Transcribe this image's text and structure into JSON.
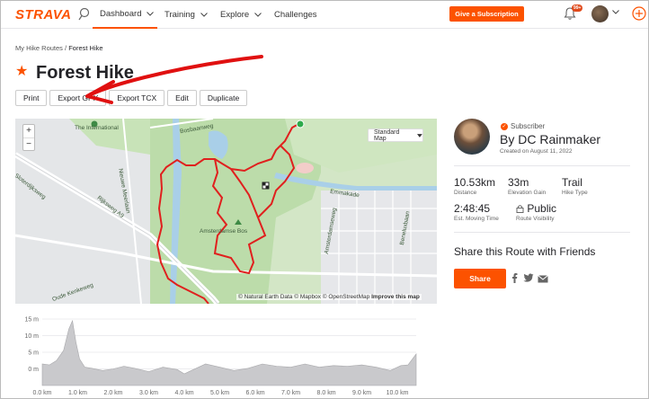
{
  "header": {
    "brand": "STRAVA",
    "nav": [
      "Dashboard",
      "Training",
      "Explore",
      "Challenges"
    ],
    "subscribe": "Give a Subscription",
    "notification_count": "99+"
  },
  "breadcrumb": {
    "parent": "My Hike Routes",
    "sep": " / ",
    "current": "Forest Hike"
  },
  "route": {
    "title": "Forest Hike"
  },
  "actions": [
    "Print",
    "Export GPX",
    "Export TCX",
    "Edit",
    "Duplicate"
  ],
  "map": {
    "zoom_in": "+",
    "zoom_out": "−",
    "type": "Standard Map",
    "labels": [
      "The International",
      "Amsterdamse Bos",
      "Bosbaanweg",
      "Nieuwe Meerlaan",
      "Rijksweg A9",
      "Emmakade",
      "Amsterdamseweg",
      "Beneluxbaan",
      "Sloterdijksweg",
      "Oude Kenkeweg"
    ],
    "attribution": {
      "prefix": "© Natural Earth Data © Mapbox © OpenStreetMap",
      "link": "Improve this map"
    }
  },
  "athlete": {
    "badge": "Subscriber",
    "name": "By DC Rainmaker",
    "created": "Created on August 11, 2022"
  },
  "stats": [
    {
      "value": "10.53km",
      "label": "Distance"
    },
    {
      "value": "33m",
      "label": "Elevation Gain"
    },
    {
      "value": "Trail",
      "label": "Hike Type"
    },
    {
      "value": "2:48:45",
      "label": "Est. Moving Time"
    },
    {
      "value": "Public",
      "label": "Route Visibility"
    }
  ],
  "share": {
    "heading": "Share this Route with Friends",
    "button": "Share"
  },
  "colors": {
    "accent": "#fc5200",
    "route": "#e0201e",
    "annotation": "#e01010"
  },
  "chart_data": {
    "type": "area",
    "xlabel": "",
    "ylabel": "",
    "ylim": [
      -5,
      15
    ],
    "xlim": [
      0,
      10.53
    ],
    "x_ticks": [
      "0.0 km",
      "1.0 km",
      "2.0 km",
      "3.0 km",
      "4.0 km",
      "5.0 km",
      "6.0 km",
      "7.0 km",
      "8.0 km",
      "9.0 km",
      "10.0 km"
    ],
    "y_ticks": [
      "15 m",
      "10 m",
      "5 m",
      "0 m"
    ],
    "x": [
      0,
      0.2,
      0.4,
      0.6,
      0.75,
      0.85,
      0.95,
      1.05,
      1.2,
      1.4,
      1.7,
      2.0,
      2.3,
      2.6,
      3.0,
      3.4,
      3.8,
      4.0,
      4.2,
      4.6,
      5.0,
      5.4,
      5.8,
      6.2,
      6.6,
      7.0,
      7.4,
      7.8,
      8.2,
      8.6,
      9.0,
      9.4,
      9.8,
      10.1,
      10.3,
      10.53
    ],
    "y": [
      1.5,
      1.2,
      2.5,
      5.5,
      12,
      14.5,
      8,
      3,
      0.5,
      0.2,
      -0.5,
      0,
      0.8,
      0.2,
      -0.8,
      0.5,
      -0.2,
      -1.5,
      -0.5,
      1.5,
      0.5,
      -0.5,
      0.2,
      1.5,
      0.8,
      0.5,
      1.5,
      0.5,
      1.0,
      0.8,
      1.2,
      0.5,
      -0.5,
      1.0,
      1.2,
      4.5
    ]
  }
}
